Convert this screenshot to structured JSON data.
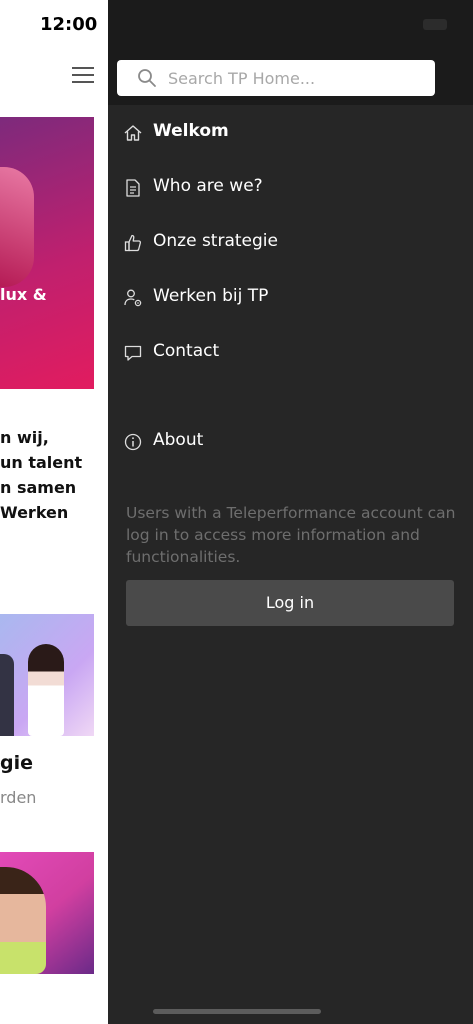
{
  "background_page": {
    "time": "12:00",
    "hero_text": "lux &",
    "paragraph_lines": [
      "n wij,",
      "un talent",
      "n samen",
      "Werken"
    ],
    "card_title": "gie",
    "card_subtitle": "rden"
  },
  "drawer": {
    "search": {
      "placeholder": "Search TP Home..."
    },
    "nav_items": [
      {
        "label": "Welkom",
        "icon": "home-icon"
      },
      {
        "label": "Who are we?",
        "icon": "document-icon"
      },
      {
        "label": "Onze strategie",
        "icon": "thumbs-up-icon"
      },
      {
        "label": "Werken bij TP",
        "icon": "person-settings-icon"
      },
      {
        "label": "Contact",
        "icon": "chat-bubble-icon"
      },
      {
        "label": "About",
        "icon": "info-icon"
      }
    ],
    "info_text": "Users with a Teleperformance account can log in to access more information and functionalities.",
    "login_label": "Log in"
  }
}
